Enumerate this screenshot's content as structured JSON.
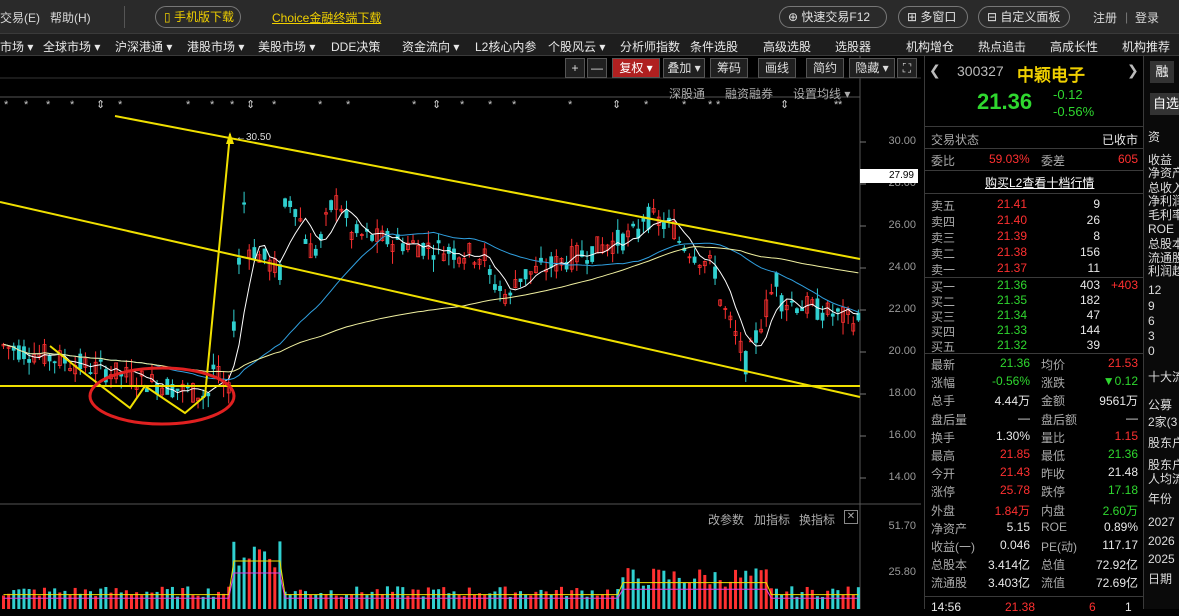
{
  "topbar": {
    "menu_left": "交易(E)",
    "menu_help": "帮助(H)",
    "mobile_btn": "手机版下载",
    "choice_link": "Choice金融终端下载",
    "quick_trade": "快速交易F12",
    "multi_window": "多窗口",
    "custom_panel": "自定义面板",
    "register": "注册",
    "login": "登录"
  },
  "navbar": [
    "市场 ▾",
    "全球市场 ▾",
    "沪深港通 ▾",
    "港股市场 ▾",
    "美股市场 ▾",
    "DDE决策",
    "资金流向 ▾",
    "L2核心内参",
    "个股风云 ▾",
    "分析师指数",
    "条件选股",
    "高级选股",
    "选股器",
    "机构增仓",
    "热点追击",
    "高成长性",
    "机构推荐"
  ],
  "toolbar": {
    "plus": "+",
    "minus": "—",
    "fq": "复权 ▾",
    "overlay": "叠加 ▾",
    "chips": "筹码",
    "draw": "画线",
    "simple": "简约",
    "hide": "隐藏 ▾"
  },
  "subtool": {
    "sgt": "深股通",
    "margin": "融资融券",
    "ma_set": "设置均线 ▾"
  },
  "price_axis": [
    "30.00",
    "28.00",
    "26.00",
    "24.00",
    "22.00",
    "20.00",
    "18.00",
    "16.00",
    "14.00"
  ],
  "price_tag": "27.99",
  "peak_label": "30.50",
  "vol_axis": [
    "51.70",
    "25.80"
  ],
  "vol_tools": {
    "param": "改参数",
    "add": "加指标",
    "swap": "换指标"
  },
  "stock": {
    "code": "300327",
    "name": "中颖电子",
    "price": "21.36",
    "change": "-0.12",
    "pct": "-0.56%",
    "rong": "融",
    "self": "自选"
  },
  "status": {
    "label": "交易状态",
    "value": "已收市"
  },
  "weibi": {
    "label": "委比",
    "value": "59.03%",
    "label2": "委差",
    "value2": "605"
  },
  "l2": "购买L2查看十档行情",
  "asks": [
    {
      "name": "卖五",
      "price": "21.41",
      "vol": "9"
    },
    {
      "name": "卖四",
      "price": "21.40",
      "vol": "26"
    },
    {
      "name": "卖三",
      "price": "21.39",
      "vol": "8"
    },
    {
      "name": "卖二",
      "price": "21.38",
      "vol": "156"
    },
    {
      "name": "卖一",
      "price": "21.37",
      "vol": "11"
    }
  ],
  "bids": [
    {
      "name": "买一",
      "price": "21.36",
      "vol": "403",
      "extra": "+403"
    },
    {
      "name": "买二",
      "price": "21.35",
      "vol": "182",
      "extra": ""
    },
    {
      "name": "买三",
      "price": "21.34",
      "vol": "47",
      "extra": ""
    },
    {
      "name": "买四",
      "price": "21.33",
      "vol": "144",
      "extra": ""
    },
    {
      "name": "买五",
      "price": "21.32",
      "vol": "39",
      "extra": ""
    }
  ],
  "stats": [
    {
      "l": "最新",
      "v": "21.36",
      "vc": "green",
      "l2": "均价",
      "v2": "21.53",
      "v2c": "red"
    },
    {
      "l": "涨幅",
      "v": "-0.56%",
      "vc": "green",
      "l2": "涨跌",
      "v2": "▼0.12",
      "v2c": "green"
    },
    {
      "l": "总手",
      "v": "4.44万",
      "vc": "white",
      "l2": "金额",
      "v2": "9561万",
      "v2c": "white"
    },
    {
      "l": "盘后量",
      "v": "—",
      "vc": "white",
      "l2": "盘后额",
      "v2": "—",
      "v2c": "white"
    },
    {
      "l": "换手",
      "v": "1.30%",
      "vc": "white",
      "l2": "量比",
      "v2": "1.15",
      "v2c": "red"
    },
    {
      "l": "最高",
      "v": "21.85",
      "vc": "red",
      "l2": "最低",
      "v2": "21.36",
      "v2c": "green"
    },
    {
      "l": "今开",
      "v": "21.43",
      "vc": "red",
      "l2": "昨收",
      "v2": "21.48",
      "v2c": "white"
    },
    {
      "l": "涨停",
      "v": "25.78",
      "vc": "red",
      "l2": "跌停",
      "v2": "17.18",
      "v2c": "green"
    },
    {
      "l": "外盘",
      "v": "1.84万",
      "vc": "red",
      "l2": "内盘",
      "v2": "2.60万",
      "v2c": "green"
    },
    {
      "l": "净资产",
      "v": "5.15",
      "vc": "white",
      "l2": "ROE",
      "v2": "0.89%",
      "v2c": "white"
    },
    {
      "l": "收益(一)",
      "v": "0.046",
      "vc": "white",
      "l2": "PE(动)",
      "v2": "117.17",
      "v2c": "white"
    },
    {
      "l": "总股本",
      "v": "3.414亿",
      "vc": "white",
      "l2": "总值",
      "v2": "72.92亿",
      "v2c": "white"
    },
    {
      "l": "流通股",
      "v": "3.403亿",
      "vc": "white",
      "l2": "流值",
      "v2": "72.69亿",
      "v2c": "white"
    }
  ],
  "tick": {
    "time": "14:56",
    "price": "21.38",
    "vol": "6",
    "n": "1"
  },
  "far_right": [
    "资",
    "收益",
    "净资产",
    "总收入",
    "净利润",
    "毛利率",
    "ROE",
    "总股本",
    "流通股",
    "利润趋",
    "12",
    "9",
    "6",
    "3",
    "0",
    "十大流",
    "公募",
    "2家(3",
    "股东户",
    "股东户",
    "人均流",
    "年份",
    "2027",
    "2026",
    "2025",
    "日期"
  ],
  "colors": {
    "up": "#ff3030",
    "down": "#2fd82f",
    "accent": "#f0d000",
    "bg": "#000000"
  }
}
